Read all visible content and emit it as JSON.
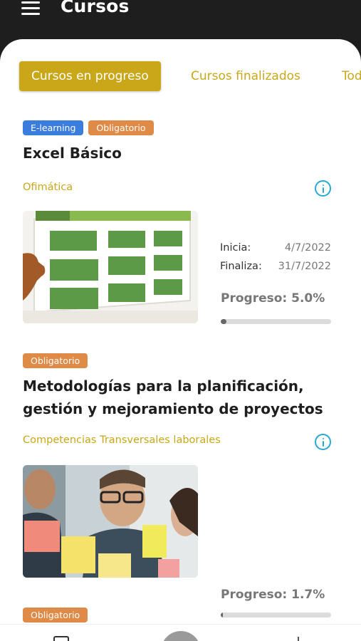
{
  "header": {
    "title": "Cursos"
  },
  "tabs": [
    {
      "label": "Cursos en progreso",
      "active": true
    },
    {
      "label": "Cursos finalizados",
      "active": false
    },
    {
      "label": "Todos",
      "active": false
    }
  ],
  "courses": [
    {
      "badges": [
        "E-learning",
        "Obligatorio"
      ],
      "title": "Excel Básico",
      "category": "Ofimática",
      "image": "spreadsheet-illustration",
      "start_label": "Inicia:",
      "start_date": "4/7/2022",
      "end_label": "Finaliza:",
      "end_date": "31/7/2022",
      "progress_text": "Progreso: 5.0%",
      "progress": 0.05
    },
    {
      "badges": [
        "Obligatorio"
      ],
      "title": "Metodologías para la planificación, gestión y mejoramiento de proyectos",
      "category": "Competencias Transversales laborales",
      "image": "team-sticky-notes-photo",
      "progress_text": "Progreso: 1.7%",
      "progress": 0.017
    },
    {
      "badges": [
        "Obligatorio"
      ]
    }
  ],
  "colors": {
    "accent": "#c9a718",
    "elearning": "#3b7ddd",
    "obligatorio": "#e08a47",
    "info": "#29a8d6"
  },
  "bottom_nav": {
    "icons": [
      "folder-icon",
      "home-icon",
      "add-icon"
    ]
  }
}
